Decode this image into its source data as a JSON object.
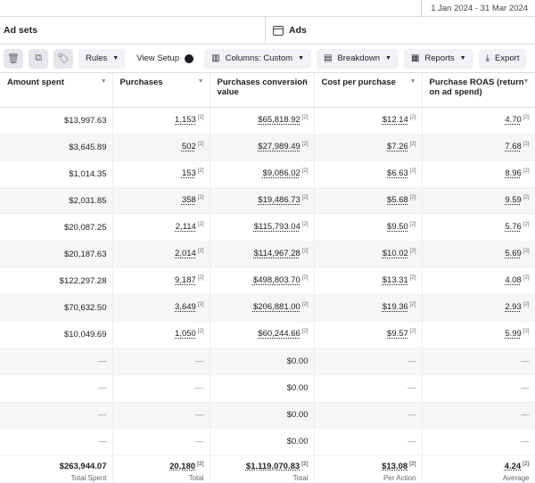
{
  "header": {
    "date_range": "1 Jan 2024 - 31 Mar 2024"
  },
  "levels": {
    "adsets_label": "Ad sets",
    "ads_label": "Ads"
  },
  "toolbar": {
    "rules_label": "Rules",
    "view_setup_label": "View Setup",
    "columns_label": "Columns: Custom",
    "breakdown_label": "Breakdown",
    "reports_label": "Reports",
    "export_label": "Export"
  },
  "table": {
    "columns": [
      "Amount spent",
      "Purchases",
      "Purchases conversion value",
      "Cost per purchase",
      "Purchase ROAS (return on ad spend)"
    ],
    "rows": [
      {
        "spent": "$13,997.63",
        "purchases": "1,153",
        "value": "$65,818.92",
        "cpp": "$12.14",
        "roas": "4.70"
      },
      {
        "spent": "$3,645.89",
        "purchases": "502",
        "value": "$27,989.49",
        "cpp": "$7.26",
        "roas": "7.68"
      },
      {
        "spent": "$1,014.35",
        "purchases": "153",
        "value": "$9,086.02",
        "cpp": "$6.63",
        "roas": "8.96"
      },
      {
        "spent": "$2,031.85",
        "purchases": "358",
        "value": "$19,486.73",
        "cpp": "$5.68",
        "roas": "9.59"
      },
      {
        "spent": "$20,087.25",
        "purchases": "2,114",
        "value": "$115,793.04",
        "cpp": "$9.50",
        "roas": "5.76"
      },
      {
        "spent": "$20,187.63",
        "purchases": "2,014",
        "value": "$114,967.28",
        "cpp": "$10.02",
        "roas": "5.69"
      },
      {
        "spent": "$122,297.28",
        "purchases": "9,187",
        "value": "$498,803.70",
        "cpp": "$13.31",
        "roas": "4.08"
      },
      {
        "spent": "$70,632.50",
        "purchases": "3,649",
        "value": "$206,881.00",
        "cpp": "$19.36",
        "roas": "2.93"
      },
      {
        "spent": "$10,049.69",
        "purchases": "1,050",
        "value": "$60,244.66",
        "cpp": "$9.57",
        "roas": "5.99"
      },
      {
        "spent": "—",
        "purchases": "—",
        "value": "$0.00",
        "cpp": "—",
        "roas": "—"
      },
      {
        "spent": "—",
        "purchases": "—",
        "value": "$0.00",
        "cpp": "—",
        "roas": "—"
      },
      {
        "spent": "—",
        "purchases": "—",
        "value": "$0.00",
        "cpp": "—",
        "roas": "—"
      },
      {
        "spent": "—",
        "purchases": "—",
        "value": "$0.00",
        "cpp": "—",
        "roas": "—"
      }
    ],
    "footnote_marker": "[2]",
    "totals": {
      "spent": "$263,944.07",
      "spent_label": "Total Spent",
      "purchases": "20,180",
      "purchases_label": "Total",
      "value": "$1,119,070.83",
      "value_label": "Total",
      "cpp": "$13.08",
      "cpp_label": "Per Action",
      "roas": "4.24",
      "roas_label": "Average"
    }
  },
  "icons": {
    "delete": "trash-icon",
    "duplicate": "duplicate-icon",
    "tag": "tag-icon",
    "columns": "columns-icon",
    "breakdown": "breakdown-icon",
    "reports": "reports-icon",
    "export": "download-icon"
  }
}
